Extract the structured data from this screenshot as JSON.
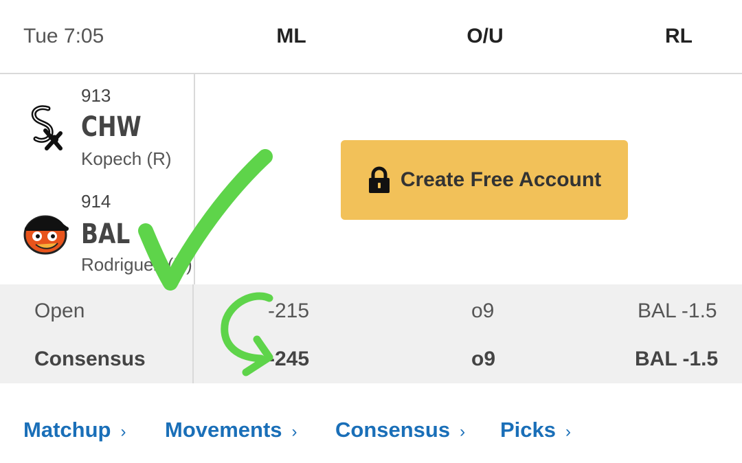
{
  "header": {
    "time": "Tue 7:05",
    "columns": {
      "ml": "ML",
      "ou": "O/U",
      "rl": "RL"
    }
  },
  "teams": [
    {
      "number": "913",
      "abbr": "CHW",
      "pitcher": "Kopech (R)",
      "logo": "white-sox-logo"
    },
    {
      "number": "914",
      "abbr": "BAL",
      "pitcher": "Rodriguez (R)",
      "logo": "orioles-logo"
    }
  ],
  "cta": {
    "label": "Create Free Account",
    "icon": "lock-icon"
  },
  "lines": {
    "open": {
      "label": "Open",
      "ml": "-215",
      "ou": "o9",
      "rl": "BAL -1.5"
    },
    "consensus": {
      "label": "Consensus",
      "ml": "-245",
      "ou": "o9",
      "rl": "BAL -1.5"
    }
  },
  "nav": {
    "matchup": "Matchup",
    "movements": "Movements",
    "consensus": "Consensus",
    "picks": "Picks",
    "chevron": "›"
  },
  "colors": {
    "accent_link": "#1a6fb8",
    "cta_background": "#f2c159",
    "annotation_green": "#5ed44a",
    "orioles_orange": "#e8541c"
  }
}
